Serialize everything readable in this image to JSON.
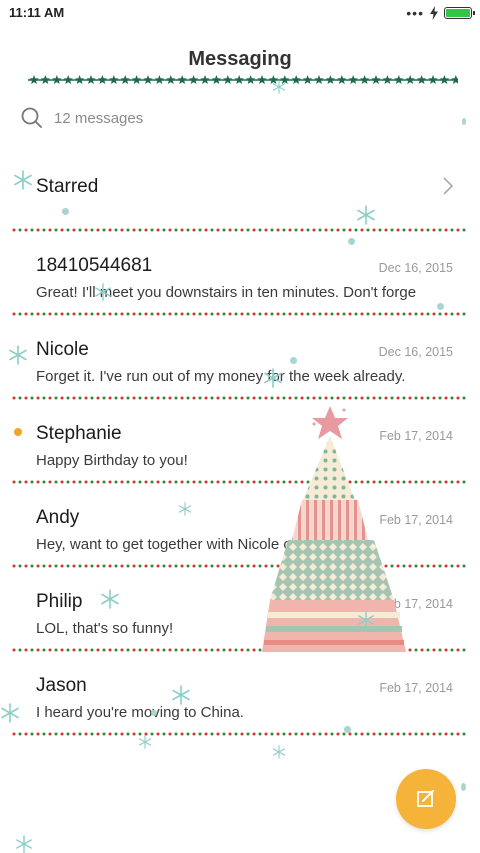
{
  "status_bar": {
    "time": "11:11 AM",
    "signal_dots": "•••"
  },
  "header": {
    "title": "Messaging"
  },
  "search": {
    "placeholder": "12 messages"
  },
  "starred": {
    "label": "Starred"
  },
  "conversations": [
    {
      "name": "18410544681",
      "date": "Dec 16, 2015",
      "preview": "Great! I'll meet you downstairs in ten minutes. Don't forge",
      "unread": false
    },
    {
      "name": "Nicole",
      "date": "Dec 16, 2015",
      "preview": "Forget it. I've run out of my money for the week already.",
      "unread": false
    },
    {
      "name": "Stephanie",
      "date": "Feb 17, 2014",
      "preview": "Happy Birthday to you!",
      "unread": true
    },
    {
      "name": "Andy",
      "date": "Feb 17, 2014",
      "preview": "Hey, want to get together with Nicole on Friday?",
      "unread": false
    },
    {
      "name": "Philip",
      "date": "Feb 17, 2014",
      "preview": "LOL, that's so funny!",
      "unread": false
    },
    {
      "name": "Jason",
      "date": "Feb 17, 2014",
      "preview": "I heard you're moving to China.",
      "unread": false
    }
  ],
  "colors": {
    "unread_dot": "#f2a524",
    "compose_button": "#f6b33a",
    "divider_red": "#d9332c",
    "divider_green": "#2e8b3a",
    "battery": "#34c548",
    "garland_star": "#1e6b4a"
  },
  "icons": {
    "search": "search-icon",
    "chevron": "chevron-right-icon",
    "compose": "compose-icon",
    "battery": "battery-icon",
    "charging": "charging-bolt-icon"
  }
}
